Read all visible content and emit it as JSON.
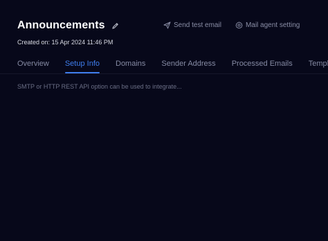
{
  "header": {
    "title": "Announcements",
    "created_text": "Created on: 15 Apr 2024 11:46 PM",
    "edit_icon": "pencil-icon"
  },
  "actions": {
    "send_test_email": {
      "label": "Send test email",
      "icon": "send-icon"
    },
    "mail_agent_setting": {
      "label": "Mail agent setting",
      "icon": "gear-icon"
    }
  },
  "tabs": [
    {
      "label": "Overview",
      "active": false
    },
    {
      "label": "Setup Info",
      "active": true
    },
    {
      "label": "Domains",
      "active": false
    },
    {
      "label": "Sender Address",
      "active": false
    },
    {
      "label": "Processed Emails",
      "active": false
    },
    {
      "label": "Templat",
      "active": false
    }
  ],
  "content": {
    "setup_text": "SMTP or HTTP REST API option can be used to integrate..."
  },
  "colors": {
    "background": "#07081a",
    "accent": "#3f7dec",
    "muted_text": "#858aa3"
  }
}
